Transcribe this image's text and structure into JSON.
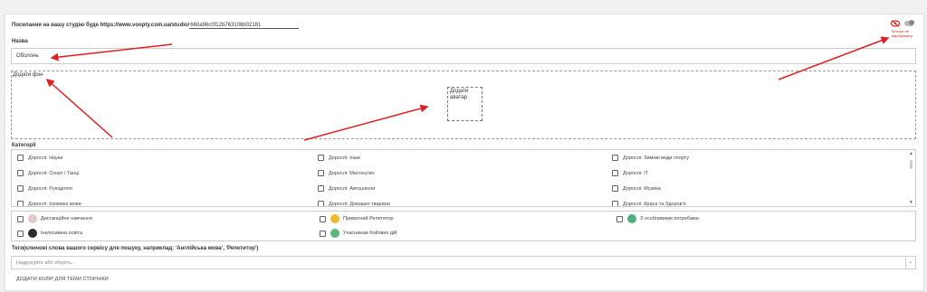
{
  "studio_link": {
    "label": "Посилання на вашу студію буде https://www.voopty.com.ua/studio/",
    "value": "660a96c0f12b763106b02181"
  },
  "visibility": {
    "label": "Більше не відображати"
  },
  "name_field": {
    "label": "Назва",
    "value": "Оболонь"
  },
  "background": {
    "label": "Додати фон"
  },
  "avatar": {
    "label": "Додати аватар"
  },
  "categories": {
    "label": "Категорії",
    "items": [
      "Дорослі: Науки",
      "Дорослі: Інше",
      "Дорослі: Зимові види спорту",
      "Дорослі: Спорт і Танці",
      "Дорослі: Мистецтво",
      "Дорослі: IT",
      "Дорослі: Рукоділля",
      "Дорослі: Автошколи",
      "Дорослі: Музика",
      "Дорослі: Іноземні мови",
      "Дорослі: Домашні тварини",
      "Дорослі: Краса та Здоров'я"
    ]
  },
  "special": {
    "items": [
      {
        "label": "Дистанційне навчання",
        "color": "#e2c8c8",
        "icon": "laptop-icon"
      },
      {
        "label": "Приватний Репетитор",
        "color": "#f2b92b",
        "icon": "tutor-icon"
      },
      {
        "label": "З особливими потребами",
        "color": "#4caf7d",
        "icon": "special-needs-icon"
      },
      {
        "label": "Інклюзивна освіта",
        "color": "#2b2b2b",
        "icon": "inclusive-icon"
      },
      {
        "label": "Учасникам бойових дій",
        "color": "#59b87a",
        "icon": "military-icon"
      }
    ]
  },
  "tags": {
    "label": "Теги(ключові слова вашого сервісу для пошуку, наприклад: 'Англійська мова', 'Репетитор')",
    "placeholder": "Надрукуйте або оберіть..."
  },
  "color_button": {
    "label": "ДОДАТИ КОЛІР ДЛЯ ТЕМИ СТОРІНКИ"
  },
  "colors": {
    "accent_red": "#e02020"
  }
}
